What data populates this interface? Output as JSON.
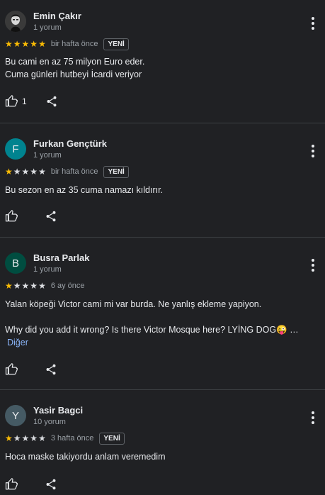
{
  "reviews": [
    {
      "name": "Emin Çakır",
      "count": "1 yorum",
      "avatar_letter": "",
      "avatar_color": "#3a3a3a",
      "rating": 5,
      "date": "bir hafta önce",
      "badge": "YENİ",
      "text_lines": [
        "Bu cami en az 75 milyon Euro eder.",
        "Cuma günleri hutbeyi İcardi veriyor"
      ],
      "likes": "1"
    },
    {
      "name": "Furkan Gençtürk",
      "count": "1 yorum",
      "avatar_letter": "F",
      "avatar_color": "#00838f",
      "rating": 1,
      "date": "bir hafta önce",
      "badge": "YENİ",
      "text_lines": [
        "Bu sezon en az 35 cuma namazı kıldırır."
      ],
      "likes": ""
    },
    {
      "name": "Busra Parlak",
      "count": "1 yorum",
      "avatar_letter": "B",
      "avatar_color": "#004d40",
      "rating": 1,
      "date": "6 ay önce",
      "badge": "",
      "text_lines": [
        "Yalan köpeği Victor cami mi var burda. Ne yanlış ekleme yapiyon."
      ],
      "text_en": "Why did you add it wrong? Is there Victor Mosque here? LYİNG DOG😜 …",
      "more_label": "Diğer",
      "likes": ""
    },
    {
      "name": "Yasir Bagci",
      "count": "10 yorum",
      "avatar_letter": "Y",
      "avatar_color": "#455a64",
      "rating": 1,
      "date": "3 hafta önce",
      "badge": "YENİ",
      "text_lines": [
        "Hoca maske takiyordu anlam veremedim"
      ],
      "likes": ""
    }
  ],
  "colors": {
    "background": "#202124",
    "star_on": "#fbbc04",
    "star_off": "#dadce0",
    "link": "#8ab4f8",
    "divider": "#3c4043"
  },
  "icons": {
    "like": "thumbs-up-icon",
    "share": "share-icon",
    "more": "more-vert-icon",
    "star": "star-icon"
  }
}
